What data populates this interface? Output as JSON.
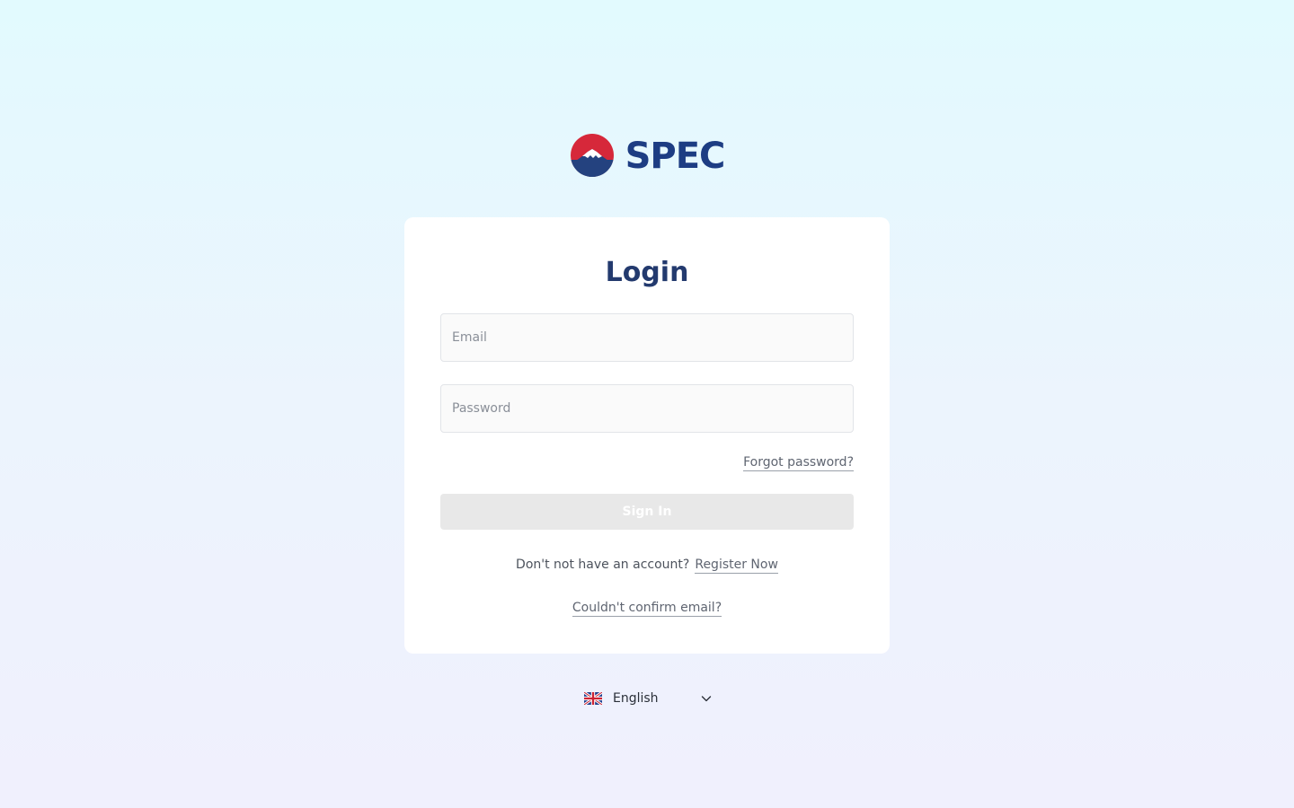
{
  "brand": {
    "name": "SPEC",
    "logo_icon": "mountain-sun-logo",
    "color": "#1d3d83",
    "accent_red": "#d6283a",
    "accent_blue": "#24427f"
  },
  "login": {
    "title": "Login",
    "email": {
      "value": "",
      "placeholder": "Email"
    },
    "password": {
      "value": "",
      "placeholder": "Password"
    },
    "forgot_label": "Forgot password?",
    "signin_label": "Sign In",
    "signin_disabled": true,
    "register_prompt": "Don't not have an account?",
    "register_label": "Register Now",
    "confirm_label": "Couldn't confirm email?"
  },
  "language": {
    "selected": "English",
    "flag_icon": "uk-flag-icon",
    "dropdown_icon": "chevron-down-icon"
  }
}
